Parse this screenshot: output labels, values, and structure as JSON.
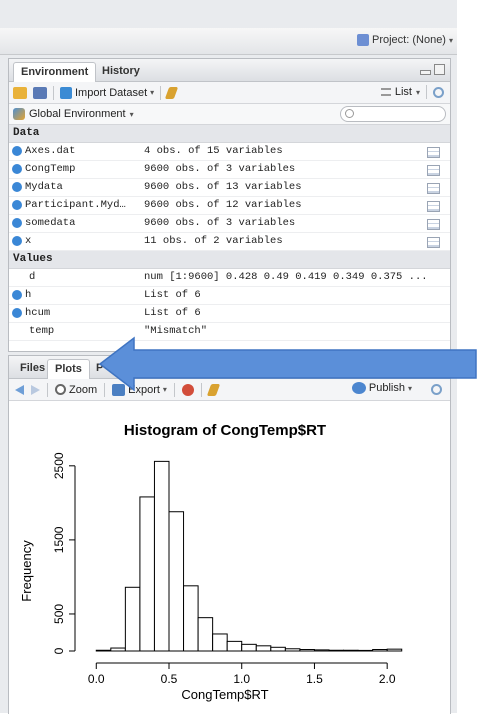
{
  "topbar": {
    "project_label": "Project: (None)",
    "project_caret": "▾"
  },
  "env_pane": {
    "tabs": [
      "Environment",
      "History"
    ],
    "toolbar": {
      "import_label": "Import Dataset",
      "list_label": "List"
    },
    "env_selector": "Global Environment",
    "sections": {
      "data_heading": "Data",
      "values_heading": "Values"
    },
    "data_rows": [
      {
        "name": "Axes.dat",
        "value": "4 obs. of 15 variables"
      },
      {
        "name": "CongTemp",
        "value": "9600 obs. of 3 variables"
      },
      {
        "name": "Mydata",
        "value": "9600 obs. of 13 variables"
      },
      {
        "name": "Participant.Myd…",
        "value": "9600 obs. of 12 variables"
      },
      {
        "name": "somedata",
        "value": "9600 obs. of 3 variables"
      },
      {
        "name": "x",
        "value": "11 obs. of 2 variables"
      }
    ],
    "value_rows": [
      {
        "name": "d",
        "value": "num [1:9600] 0.428 0.49 0.419 0.349 0.375 ...",
        "expandable": false
      },
      {
        "name": "h",
        "value": "List of 6",
        "expandable": true
      },
      {
        "name": "hcum",
        "value": "List of 6",
        "expandable": true
      },
      {
        "name": "temp",
        "value": "\"Mismatch\"",
        "expandable": false
      }
    ]
  },
  "files_pane": {
    "tabs": [
      "Files",
      "Plots",
      "P"
    ],
    "toolbar": {
      "zoom_label": "Zoom",
      "export_label": "Export",
      "publish_label": "Publish"
    }
  },
  "chart_data": {
    "type": "bar",
    "title": "Histogram of CongTemp$RT",
    "xlabel": "CongTemp$RT",
    "ylabel": "Frequency",
    "bin_width": 0.1,
    "bins_start": [
      0.0,
      0.1,
      0.2,
      0.3,
      0.4,
      0.5,
      0.6,
      0.7,
      0.8,
      0.9,
      1.0,
      1.1,
      1.2,
      1.3,
      1.4,
      1.5,
      1.6,
      1.7,
      1.8,
      1.9,
      2.0
    ],
    "values": [
      10,
      40,
      860,
      2080,
      2560,
      1880,
      880,
      450,
      230,
      130,
      90,
      70,
      50,
      30,
      20,
      15,
      10,
      10,
      8,
      20,
      25
    ],
    "xlim": [
      -0.05,
      2.15
    ],
    "ylim": [
      0,
      2700
    ],
    "x_ticks": [
      "0.0",
      "0.5",
      "1.0",
      "1.5",
      "2.0"
    ],
    "x_tick_values": [
      0.0,
      0.5,
      1.0,
      1.5,
      2.0
    ],
    "y_ticks": [
      "0",
      "500",
      "1500",
      "2500"
    ],
    "y_tick_values": [
      0,
      500,
      1500,
      2500
    ],
    "grid": false
  },
  "colors": {
    "callout_arrow": "#5b8fd9",
    "expand_dot": "#3a87d6"
  }
}
